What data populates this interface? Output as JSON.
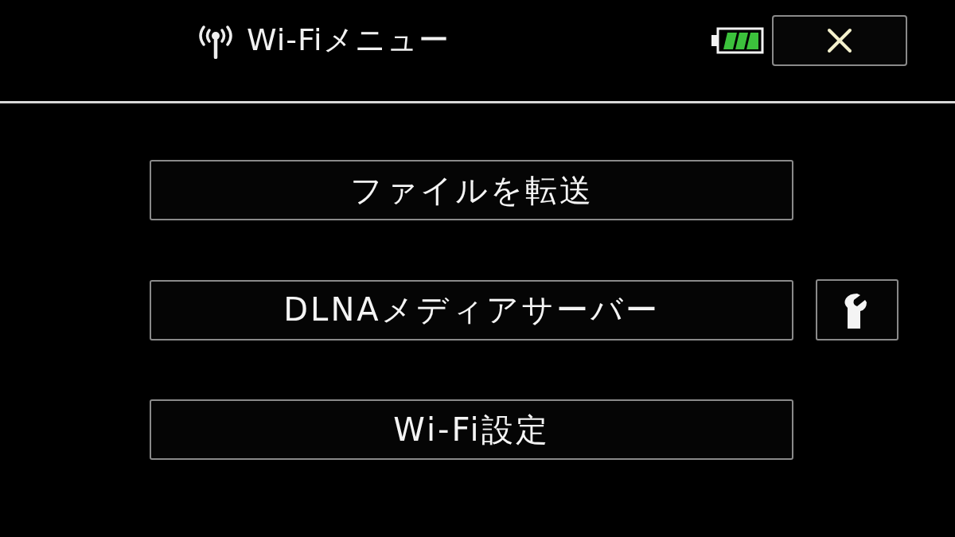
{
  "header": {
    "title": "Wi-Fiメニュー"
  },
  "menu": [
    {
      "label": "ファイルを転送",
      "kind": "plain"
    },
    {
      "label": "DLNAメディアサーバー",
      "kind": "settings"
    },
    {
      "label": "Wi-Fi設定",
      "kind": "plain"
    }
  ]
}
